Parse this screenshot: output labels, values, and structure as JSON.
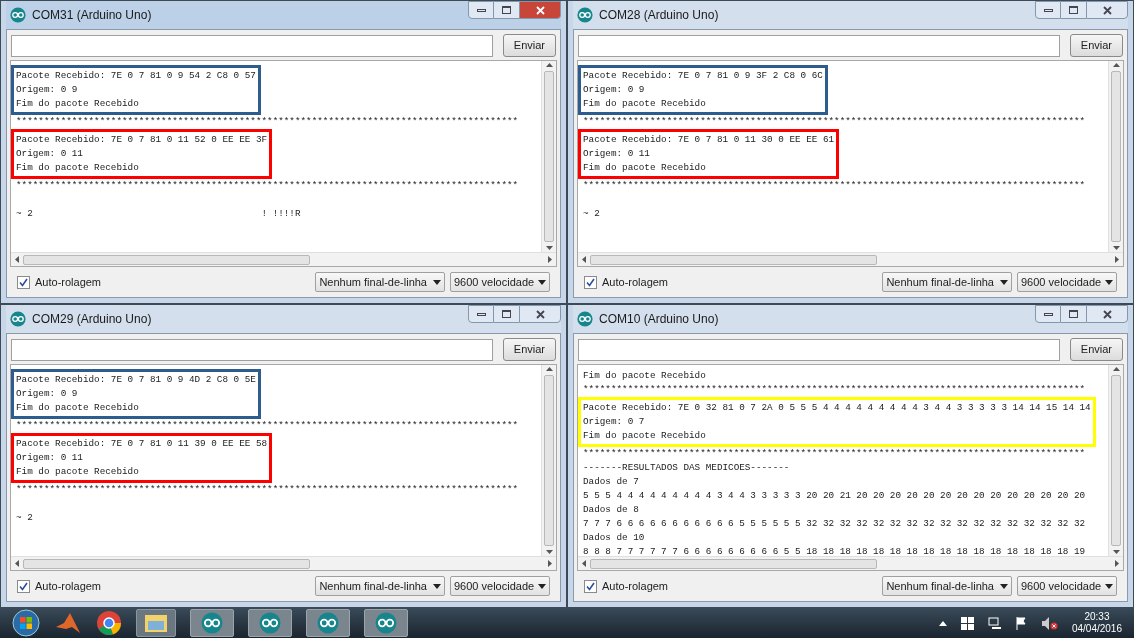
{
  "windows": [
    {
      "title": "COM31 (Arduino Uno)",
      "active": true,
      "send_button": "Enviar",
      "output": [
        {
          "kind": "group",
          "color": "#2d5c8e",
          "lines": [
            "Pacote Recebido: 7E 0 7 81 0 9 54 2 C8 0 57",
            "Origem: 0 9",
            "Fim do pacote Recebido"
          ]
        },
        {
          "kind": "line",
          "text": "******************************************************************************************"
        },
        {
          "kind": "group",
          "color": "#ff0000",
          "lines": [
            "Pacote Recebido: 7E 0 7 81 0 11 52 0 EE EE 3F",
            "Origem: 0 11",
            "Fim do pacote Recebido"
          ]
        },
        {
          "kind": "line",
          "text": "******************************************************************************************"
        },
        {
          "kind": "blank"
        },
        {
          "kind": "line",
          "text": "~ 2                                         ! !!!!R"
        }
      ],
      "autoscroll": {
        "label": "Auto-rolagem",
        "checked": true
      },
      "line_ending": "Nenhum final-de-linha",
      "baud": "9600 velocidade"
    },
    {
      "title": "COM28 (Arduino Uno)",
      "active": false,
      "send_button": "Enviar",
      "output": [
        {
          "kind": "group",
          "color": "#2d5c8e",
          "lines": [
            "Pacote Recebido: 7E 0 7 81 0 9 3F 2 C8 0 6C",
            "Origem: 0 9",
            "Fim do pacote Recebido"
          ]
        },
        {
          "kind": "line",
          "text": "******************************************************************************************"
        },
        {
          "kind": "group",
          "color": "#ff0000",
          "lines": [
            "Pacote Recebido: 7E 0 7 81 0 11 30 0 EE EE 61",
            "Origem: 0 11",
            "Fim do pacote Recebido"
          ]
        },
        {
          "kind": "line",
          "text": "******************************************************************************************"
        },
        {
          "kind": "blank"
        },
        {
          "kind": "line",
          "text": "~ 2"
        }
      ],
      "autoscroll": {
        "label": "Auto-rolagem",
        "checked": true
      },
      "line_ending": "Nenhum final-de-linha",
      "baud": "9600 velocidade"
    },
    {
      "title": "COM29 (Arduino Uno)",
      "active": false,
      "send_button": "Enviar",
      "output": [
        {
          "kind": "group",
          "color": "#2d5c8e",
          "lines": [
            "Pacote Recebido: 7E 0 7 81 0 9 4D 2 C8 0 5E",
            "Origem: 0 9",
            "Fim do pacote Recebido"
          ]
        },
        {
          "kind": "line",
          "text": "******************************************************************************************"
        },
        {
          "kind": "group",
          "color": "#ff0000",
          "lines": [
            "Pacote Recebido: 7E 0 7 81 0 11 39 0 EE EE 58",
            "Origem: 0 11",
            "Fim do pacote Recebido"
          ]
        },
        {
          "kind": "line",
          "text": "******************************************************************************************"
        },
        {
          "kind": "blank"
        },
        {
          "kind": "line",
          "text": "~ 2"
        }
      ],
      "autoscroll": {
        "label": "Auto-rolagem",
        "checked": true
      },
      "line_ending": "Nenhum final-de-linha",
      "baud": "9600 velocidade"
    },
    {
      "title": "COM10 (Arduino Uno)",
      "active": false,
      "send_button": "Enviar",
      "output": [
        {
          "kind": "line",
          "text": "Fim do pacote Recebido"
        },
        {
          "kind": "line",
          "text": "******************************************************************************************"
        },
        {
          "kind": "group",
          "color": "#ffff00",
          "lines": [
            "Pacote Recebido: 7E 0 32 81 0 7 2A 0 5 5 5 4 4 4 4 4 4 4 4 4 3 4 4 3 3 3 3 3 14 14 15 14 14",
            "Origem: 0 7",
            "Fim do pacote Recebido"
          ]
        },
        {
          "kind": "line",
          "text": "******************************************************************************************"
        },
        {
          "kind": "line",
          "text": "-------RESULTADOS DAS MEDICOES-------"
        },
        {
          "kind": "line",
          "text": "Dados de 7"
        },
        {
          "kind": "line",
          "text": "5 5 5 4 4 4 4 4 4 4 4 4 3 4 4 3 3 3 3 3 20 20 21 20 20 20 20 20 20 20 20 20 20 20 20 20 20"
        },
        {
          "kind": "line",
          "text": "Dados de 8"
        },
        {
          "kind": "line",
          "text": "7 7 7 6 6 6 6 6 6 6 6 6 6 6 5 5 5 5 5 5 32 32 32 32 32 32 32 32 32 32 32 32 32 32 32 32 32"
        },
        {
          "kind": "line",
          "text": "Dados de 10"
        },
        {
          "kind": "line",
          "text": "8 8 8 7 7 7 7 7 7 6 6 6 6 6 6 6 6 6 5 5 18 18 18 18 18 18 18 18 18 18 18 18 18 18 18 18 19"
        }
      ],
      "autoscroll": {
        "label": "Auto-rolagem",
        "checked": true
      },
      "line_ending": "Nenhum final-de-linha",
      "baud": "9600 velocidade"
    }
  ],
  "taskbar": {
    "time": "20:33",
    "date": "04/04/2016"
  }
}
